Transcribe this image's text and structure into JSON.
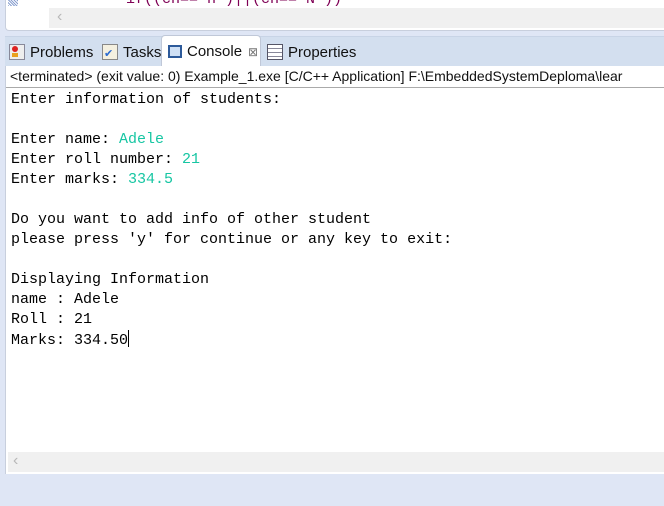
{
  "editor": {
    "code_fragment": "if((ch=='n')||(ch=='N'))"
  },
  "tabs": [
    {
      "label": "Problems",
      "icon": "problems-icon"
    },
    {
      "label": "Tasks",
      "icon": "tasks-icon"
    },
    {
      "label": "Console",
      "icon": "console-icon",
      "active": true,
      "close": "⊠"
    },
    {
      "label": "Properties",
      "icon": "properties-icon"
    }
  ],
  "console": {
    "header": "<terminated> (exit value: 0) Example_1.exe [C/C++ Application] F:\\EmbeddedSystemDeploma\\lear",
    "lines": [
      {
        "text": "Enter information of students:"
      },
      {
        "text": ""
      },
      {
        "text": "Enter name: ",
        "input": "Adele"
      },
      {
        "text": "Enter roll number: ",
        "input": "21"
      },
      {
        "text": "Enter marks: ",
        "input": "334.5"
      },
      {
        "text": ""
      },
      {
        "text": "Do you want to add info of other student"
      },
      {
        "text": "please press 'y' for continue or any key to exit:"
      },
      {
        "text": ""
      },
      {
        "text": "Displaying Information"
      },
      {
        "text": "name : Adele"
      },
      {
        "text": "Roll : 21"
      },
      {
        "text": "Marks: 334.50"
      }
    ]
  },
  "colors": {
    "input": "#17c6a3",
    "tabbar": "#d3dfef"
  }
}
